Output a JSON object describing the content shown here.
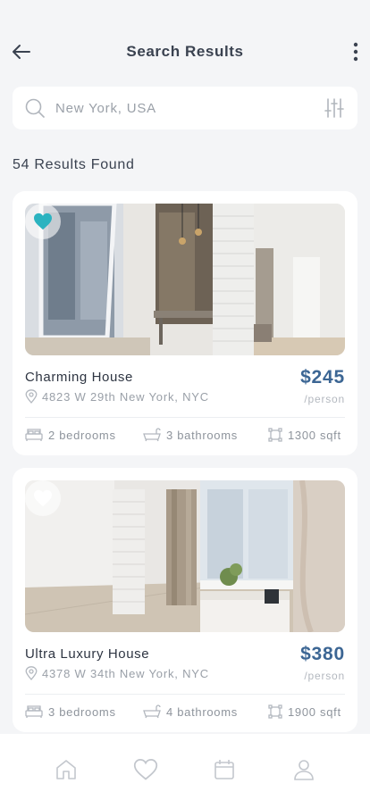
{
  "header": {
    "title": "Search Results",
    "back_icon": "arrow-left-icon",
    "more_icon": "more-vertical-icon"
  },
  "search": {
    "placeholder": "New York, USA",
    "search_icon": "search-icon",
    "filter_icon": "sliders-icon"
  },
  "results": {
    "count_text": "54 Results Found"
  },
  "listings": [
    {
      "name": "Charming House",
      "address": "4823 W 29th New York, NYC",
      "price": "$245",
      "unit": "/person",
      "bedrooms": "2 bedrooms",
      "bathrooms": "3 bathrooms",
      "area": "1300 sqft",
      "favorited": true
    },
    {
      "name": "Ultra Luxury House",
      "address": "4378 W 34th New York, NYC",
      "price": "$380",
      "unit": "/person",
      "bedrooms": "3 bedrooms",
      "bathrooms": "4 bathrooms",
      "area": "1900 sqft",
      "favorited": false
    }
  ],
  "bottom_nav": {
    "items": [
      "home-icon",
      "heart-icon",
      "calendar-icon",
      "user-icon"
    ]
  },
  "colors": {
    "accent": "#3c6694",
    "favorite": "#2bb3c0",
    "background": "#f4f5f7"
  }
}
